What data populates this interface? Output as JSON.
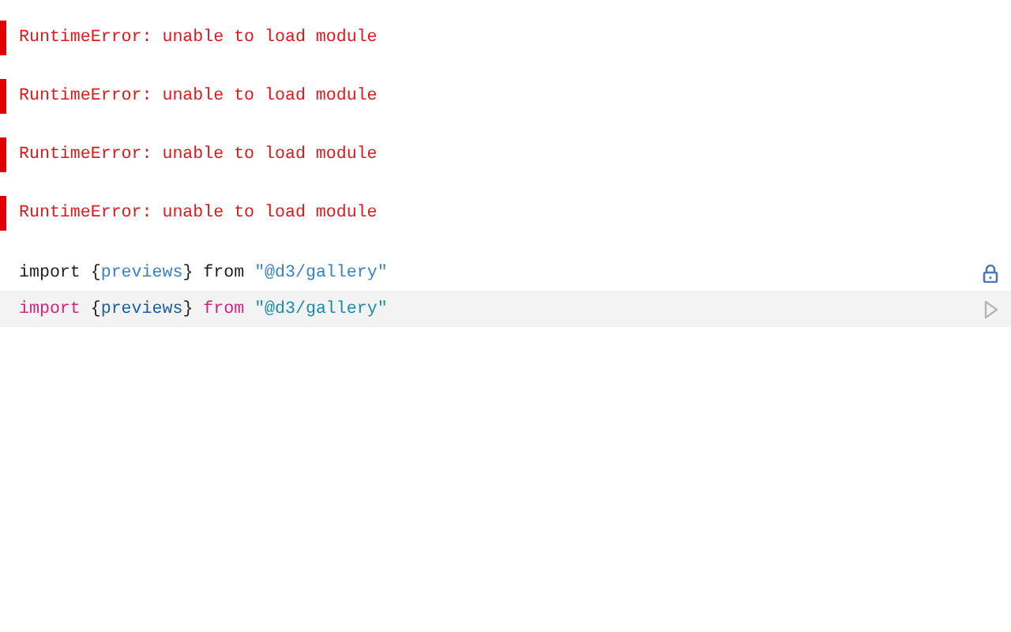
{
  "errors": [
    {
      "message": "RuntimeError: unable to load module"
    },
    {
      "message": "RuntimeError: unable to load module"
    },
    {
      "message": "RuntimeError: unable to load module"
    },
    {
      "message": "RuntimeError: unable to load module"
    }
  ],
  "cells": [
    {
      "selected": false,
      "kind": "locked",
      "tokens": [
        {
          "kind": "keyword",
          "text": "import "
        },
        {
          "kind": "punct",
          "text": "{"
        },
        {
          "kind": "variable",
          "text": "previews"
        },
        {
          "kind": "punct",
          "text": "} "
        },
        {
          "kind": "keyword",
          "text": "from "
        },
        {
          "kind": "string",
          "text": "\"@d3/gallery\""
        }
      ]
    },
    {
      "selected": true,
      "kind": "runnable",
      "tokens": [
        {
          "kind": "keyword",
          "text": "import "
        },
        {
          "kind": "punct",
          "text": "{"
        },
        {
          "kind": "variable",
          "text": "previews"
        },
        {
          "kind": "punct",
          "text": "} "
        },
        {
          "kind": "keyword",
          "text": "from "
        },
        {
          "kind": "string",
          "text": "\"@d3/gallery\""
        }
      ]
    }
  ]
}
